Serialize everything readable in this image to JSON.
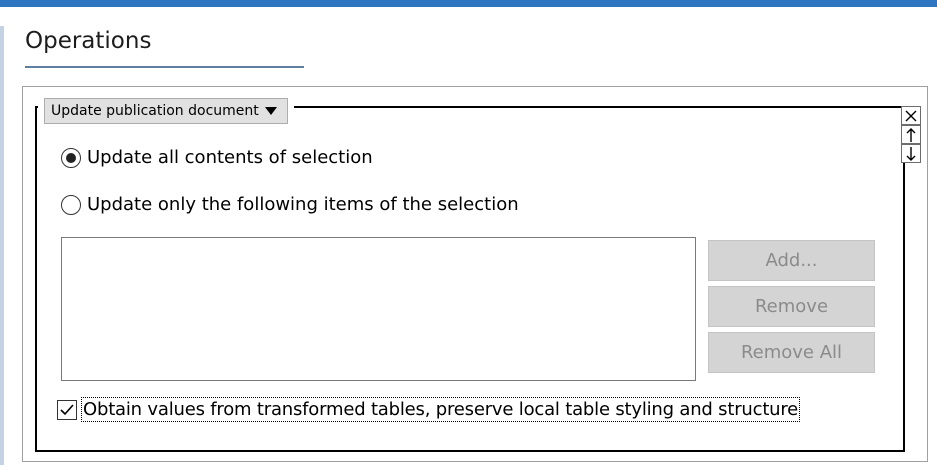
{
  "colors": {
    "top_bar": "#2f76c2",
    "left_accent": "#c5d2e3",
    "title_underline": "#5f7f9e",
    "disabled_button_bg": "#d4d4d4",
    "disabled_button_text": "#8b8b8b"
  },
  "section": {
    "title": "Operations"
  },
  "operation": {
    "selected": "Update publication document",
    "dropdown_icon": "triangle-down-icon"
  },
  "side_buttons": [
    {
      "icon": "close-icon",
      "glyph": "×"
    },
    {
      "icon": "arrow-up-icon",
      "glyph": "↑"
    },
    {
      "icon": "arrow-down-icon",
      "glyph": "↓"
    }
  ],
  "options": {
    "update_all_label": "Update all contents of selection",
    "update_all_selected": true,
    "update_only_label": "Update only the following items of the selection",
    "update_only_selected": false
  },
  "items_list": {
    "items": []
  },
  "buttons": {
    "add_label": "Add...",
    "remove_label": "Remove",
    "remove_all_label": "Remove All",
    "enabled": false
  },
  "obtain_values": {
    "label": "Obtain values from transformed tables, preserve local table styling and structure",
    "checked": true
  }
}
